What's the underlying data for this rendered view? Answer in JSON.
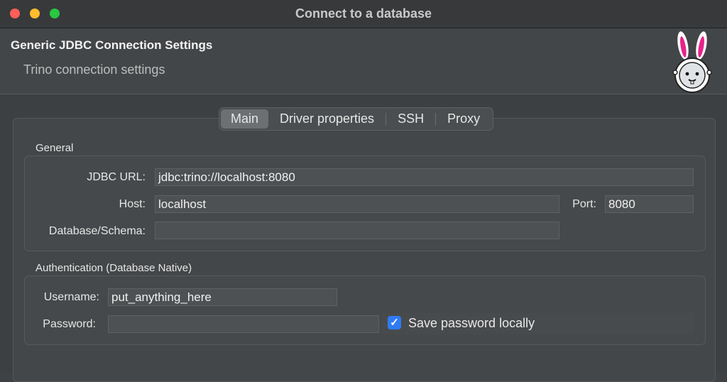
{
  "window": {
    "title": "Connect to a database"
  },
  "header": {
    "title": "Generic JDBC Connection Settings",
    "subtitle": "Trino connection settings",
    "logo_icon": "bunny-astronaut-icon"
  },
  "tabs": [
    {
      "label": "Main",
      "active": true
    },
    {
      "label": "Driver properties",
      "active": false
    },
    {
      "label": "SSH",
      "active": false
    },
    {
      "label": "Proxy",
      "active": false
    }
  ],
  "general": {
    "label": "General",
    "jdbc_url": {
      "label": "JDBC URL:",
      "value": "jdbc:trino://localhost:8080"
    },
    "host": {
      "label": "Host:",
      "value": "localhost"
    },
    "port": {
      "label": "Port:",
      "value": "8080"
    },
    "database": {
      "label": "Database/Schema:",
      "value": ""
    }
  },
  "auth": {
    "label": "Authentication (Database Native)",
    "username": {
      "label": "Username:",
      "value": "put_anything_here"
    },
    "password": {
      "label": "Password:",
      "value": ""
    },
    "save_password": {
      "label": "Save password locally",
      "checked": true
    }
  },
  "colors": {
    "close": "#fe5f57",
    "minimize": "#febc2e",
    "zoom": "#28c840",
    "accent": "#2f7bf5"
  }
}
